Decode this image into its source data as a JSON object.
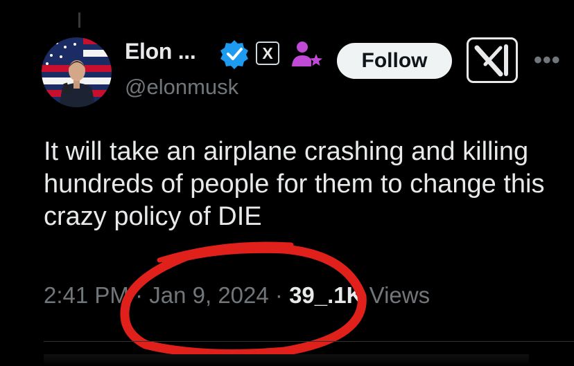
{
  "author": {
    "display_name": "Elon ...",
    "handle": "@elonmusk",
    "affiliate_badge_text": "X"
  },
  "actions": {
    "follow_label": "Follow",
    "more_label": "•••"
  },
  "tweet": {
    "text": "It will take an airplane crashing and killing hundreds of people for them to change this crazy policy of DIE",
    "time": "2:41 PM",
    "date": "Jan 9, 2024",
    "separator": "·",
    "views_count": "39_.1K",
    "views_label": "Views"
  },
  "colors": {
    "background": "#000000",
    "text": "#e7e9ea",
    "muted": "#71767b",
    "verified_blue": "#1d9bf0",
    "affiliate_purple": "#c049d6",
    "annotation_red": "#e0201b"
  },
  "icons": {
    "verified": "verified-check-icon",
    "affiliate": "affiliate-user-icon",
    "grok": "grok-logo-icon",
    "more": "more-options-icon"
  }
}
